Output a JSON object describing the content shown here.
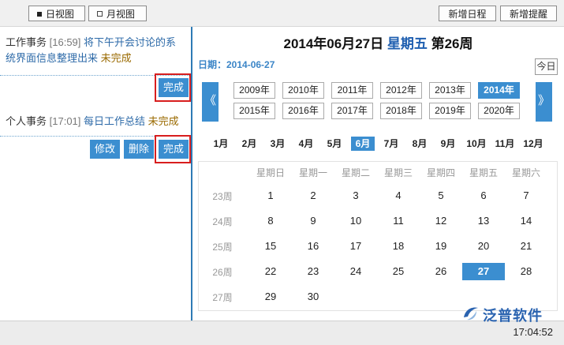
{
  "toolbar": {
    "day_view": "日视图",
    "month_view": "月视图",
    "new_schedule": "新增日程",
    "new_reminder": "新增提醒"
  },
  "tasks": [
    {
      "type": "工作事务",
      "time": "[16:59]",
      "title": "将下午开会讨论的系统界面信息整理出来",
      "status": "未完成",
      "actions": [
        "完成"
      ]
    },
    {
      "type": "个人事务",
      "time": "[17:01]",
      "title": "每日工作总结",
      "status": "未完成",
      "actions": [
        "修改",
        "删除",
        "完成"
      ]
    }
  ],
  "calendar": {
    "title_date": "2014年06月27日",
    "title_weekday": "星期五",
    "title_week": "第26周",
    "date_label": "日期：2014-06-27",
    "today_button": "今日",
    "prev_icon": "《",
    "next_icon": "》",
    "years_row1": [
      "2009年",
      "2010年",
      "2011年",
      "2012年",
      "2013年",
      "2014年"
    ],
    "years_row2": [
      "2015年",
      "2016年",
      "2017年",
      "2018年",
      "2019年",
      "2020年"
    ],
    "selected_year": "2014年",
    "months": [
      "1月",
      "2月",
      "3月",
      "4月",
      "5月",
      "6月",
      "7月",
      "8月",
      "9月",
      "10月",
      "11月",
      "12月"
    ],
    "selected_month": "6月",
    "weekdays": [
      "星期日",
      "星期一",
      "星期二",
      "星期三",
      "星期四",
      "星期五",
      "星期六"
    ],
    "weeks": [
      {
        "label": "23周",
        "days": [
          "1",
          "2",
          "3",
          "4",
          "5",
          "6",
          "7"
        ]
      },
      {
        "label": "24周",
        "days": [
          "8",
          "9",
          "10",
          "11",
          "12",
          "13",
          "14"
        ]
      },
      {
        "label": "25周",
        "days": [
          "15",
          "16",
          "17",
          "18",
          "19",
          "20",
          "21"
        ]
      },
      {
        "label": "26周",
        "days": [
          "22",
          "23",
          "24",
          "25",
          "26",
          "27",
          "28"
        ]
      },
      {
        "label": "27周",
        "days": [
          "29",
          "30",
          "",
          "",
          "",
          "",
          ""
        ]
      }
    ],
    "selected_day": "27"
  },
  "colors": {
    "accent": "#3b8ed0",
    "highlight_border": "#d81e1e",
    "link": "#2d6aa8",
    "status_pending": "#9a6a00"
  },
  "status": {
    "clock": "17:04:52",
    "brand": "泛普软件",
    "brand_url": "www.fanpu..."
  }
}
